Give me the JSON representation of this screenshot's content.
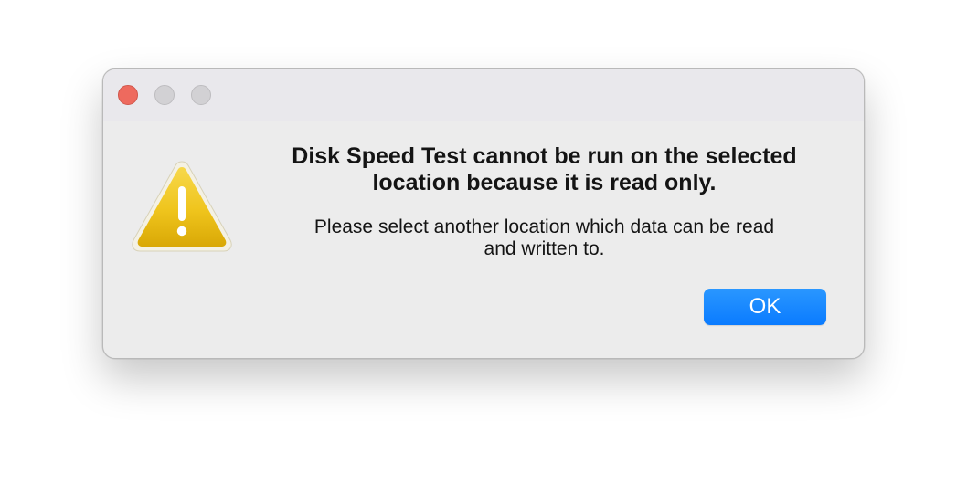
{
  "dialog": {
    "title_lines": [
      "Disk Speed Test cannot be run on the selected",
      "location because it is read only."
    ],
    "message_lines": [
      "Please select another location which data can be read",
      "and written to."
    ],
    "ok_label": "OK",
    "icon": "warning-triangle-icon"
  },
  "window_controls": {
    "close": "close-button",
    "minimize": "minimize-button",
    "zoom": "zoom-button"
  },
  "colors": {
    "accent": "#0a7bff",
    "close_red": "#ee6a5e",
    "inactive_gray": "#d2d1d4",
    "warning_yellow": "#f2c417",
    "window_bg": "#ececec"
  }
}
